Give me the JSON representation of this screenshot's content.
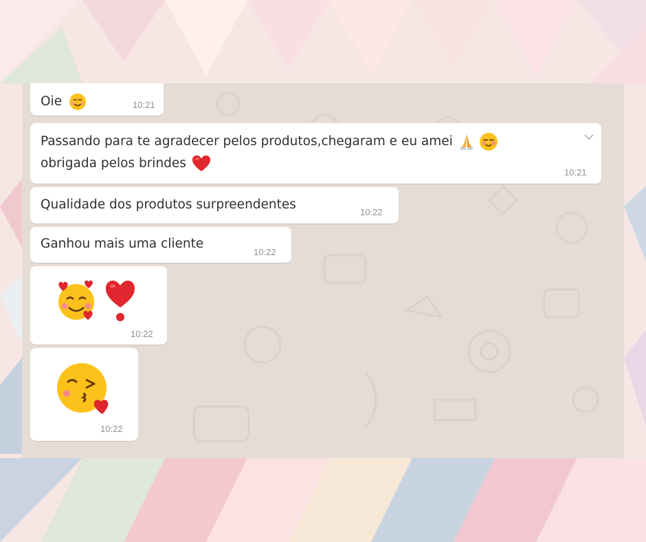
{
  "messages": [
    {
      "text": "Oie",
      "emoji": [
        "smiling-face-with-smiling-eyes"
      ],
      "time": "10:21"
    },
    {
      "line1": "Passando para te agradecer pelos produtos,chegaram e eu amei",
      "line1_emoji": [
        "folded-hands",
        "smiling-face"
      ],
      "line2": "obrigada pelos brindes",
      "line2_emoji": [
        "red-heart"
      ],
      "time": "10:21"
    },
    {
      "text": "Qualidade dos produtos surpreendentes",
      "time": "10:22"
    },
    {
      "text": "Ganhou mais uma cliente",
      "time": "10:22"
    },
    {
      "emoji": [
        "smiling-face-with-hearts",
        "heavy-heart-exclamation"
      ],
      "time": "10:22"
    },
    {
      "emoji": [
        "face-blowing-a-kiss"
      ],
      "time": "10:22"
    }
  ],
  "colors": {
    "chat_background": "#e5ddd5",
    "bubble": "#ffffff",
    "text": "#303030",
    "timestamp": "#8f8f8f",
    "page_background": "#f7e9e6"
  }
}
